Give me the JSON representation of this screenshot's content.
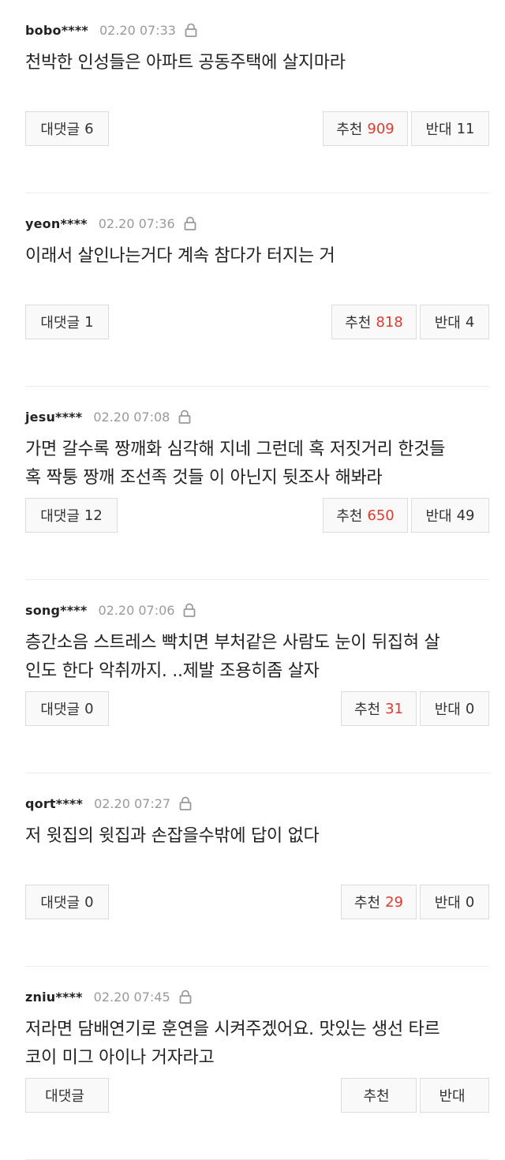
{
  "comments": [
    {
      "user": "bobo****",
      "time": "02.20 07:33",
      "lines": [
        "천박한 인성들은 아파트 공동주택에 살지마라"
      ],
      "reply_label": "대댓글",
      "reply_count": "6",
      "recommend_label": "추천",
      "recommend_count": "909",
      "oppose_label": "반대",
      "oppose_count": "11"
    },
    {
      "user": "yeon****",
      "time": "02.20 07:36",
      "lines": [
        "이래서 살인나는거다 계속 참다가 터지는 거"
      ],
      "reply_label": "대댓글",
      "reply_count": "1",
      "recommend_label": "추천",
      "recommend_count": "818",
      "oppose_label": "반대",
      "oppose_count": "4"
    },
    {
      "user": "jesu****",
      "time": "02.20 07:08",
      "lines": [
        "가면 갈수록 짱깨화 심각해 지네 그런데 혹 저짓거리 한것들",
        "혹 짝퉁 짱깨 조선족 것들 이 아닌지 뒷조사 해봐라"
      ],
      "reply_label": "대댓글",
      "reply_count": "12",
      "recommend_label": "추천",
      "recommend_count": "650",
      "oppose_label": "반대",
      "oppose_count": "49"
    },
    {
      "user": "song****",
      "time": "02.20 07:06",
      "lines": [
        "층간소음 스트레스 빡치면 부처같은 사람도 눈이 뒤집혀 살",
        "인도 한다 악취까지. ..제발 조용히좀 살자"
      ],
      "reply_label": "대댓글",
      "reply_count": "0",
      "recommend_label": "추천",
      "recommend_count": "31",
      "oppose_label": "반대",
      "oppose_count": "0"
    },
    {
      "user": "qort****",
      "time": "02.20 07:27",
      "lines": [
        "저 윗집의 윗집과 손잡을수밖에 답이 없다"
      ],
      "reply_label": "대댓글",
      "reply_count": "0",
      "recommend_label": "추천",
      "recommend_count": "29",
      "oppose_label": "반대",
      "oppose_count": "0"
    },
    {
      "user": "zniu****",
      "time": "02.20 07:45",
      "lines": [
        "저라면 담배연기로 훈연을 시켜주겠어요. 맛있는 생선 타르",
        "코이 미그 아이나 거자라고"
      ],
      "reply_label": "대댓글",
      "reply_count": "",
      "recommend_label": "추천",
      "recommend_count": "",
      "oppose_label": "반대",
      "oppose_count": ""
    }
  ],
  "colors": {
    "recommend_count": "#e03a2f",
    "time": "#9a9a9a",
    "button_border": "#dcdcdc",
    "button_bg": "#f9f9f9"
  },
  "icons": {
    "lock": "lock-icon"
  }
}
